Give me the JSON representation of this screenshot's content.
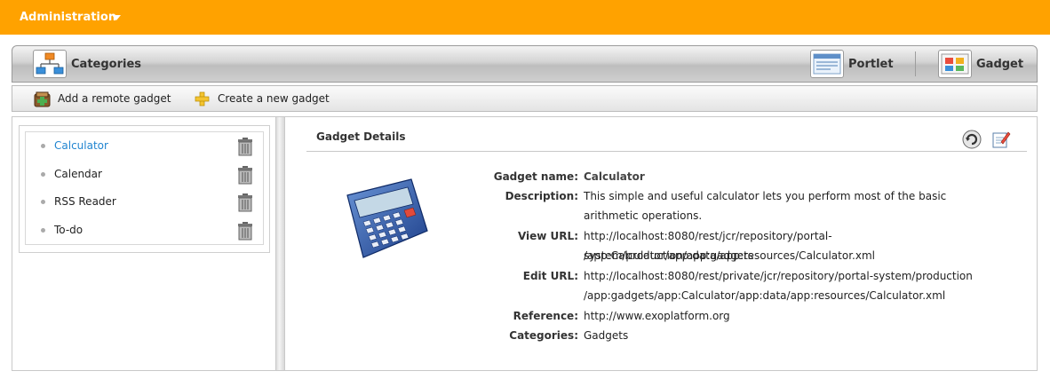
{
  "topbar": {
    "title": "Administration"
  },
  "tabsbar": {
    "categories_label": "Categories",
    "tabs": [
      {
        "label": "Portlet"
      },
      {
        "label": "Gadget"
      }
    ]
  },
  "actions": {
    "add_remote": "Add a remote gadget",
    "create_new": "Create a new gadget"
  },
  "gadget_list": [
    {
      "name": "Calculator",
      "active": true
    },
    {
      "name": "Calendar"
    },
    {
      "name": "RSS Reader"
    },
    {
      "name": "To-do"
    }
  ],
  "details": {
    "title": "Gadget Details",
    "fields": {
      "gadget_name_label": "Gadget name:",
      "gadget_name": "Calculator",
      "description_label": "Description:",
      "description": "This simple and useful calculator lets you perform most of the basic arithmetic operations.",
      "view_url_label": "View URL:",
      "view_url_1": "http://localhost:8080/rest/jcr/repository/portal-system/production/app:gadgets",
      "view_url_2": "/app:Calculator/app:data/app:resources/Calculator.xml",
      "edit_url_label": "Edit URL:",
      "edit_url_1": "http://localhost:8080/rest/private/jcr/repository/portal-system/production",
      "edit_url_2": "/app:gadgets/app:Calculator/app:data/app:resources/Calculator.xml",
      "reference_label": "Reference:",
      "reference": "http://www.exoplatform.org",
      "categories_label": "Categories:",
      "categories": "Gadgets"
    }
  },
  "colors": {
    "topbar": "#ffa200",
    "active_link": "#2185d0"
  }
}
